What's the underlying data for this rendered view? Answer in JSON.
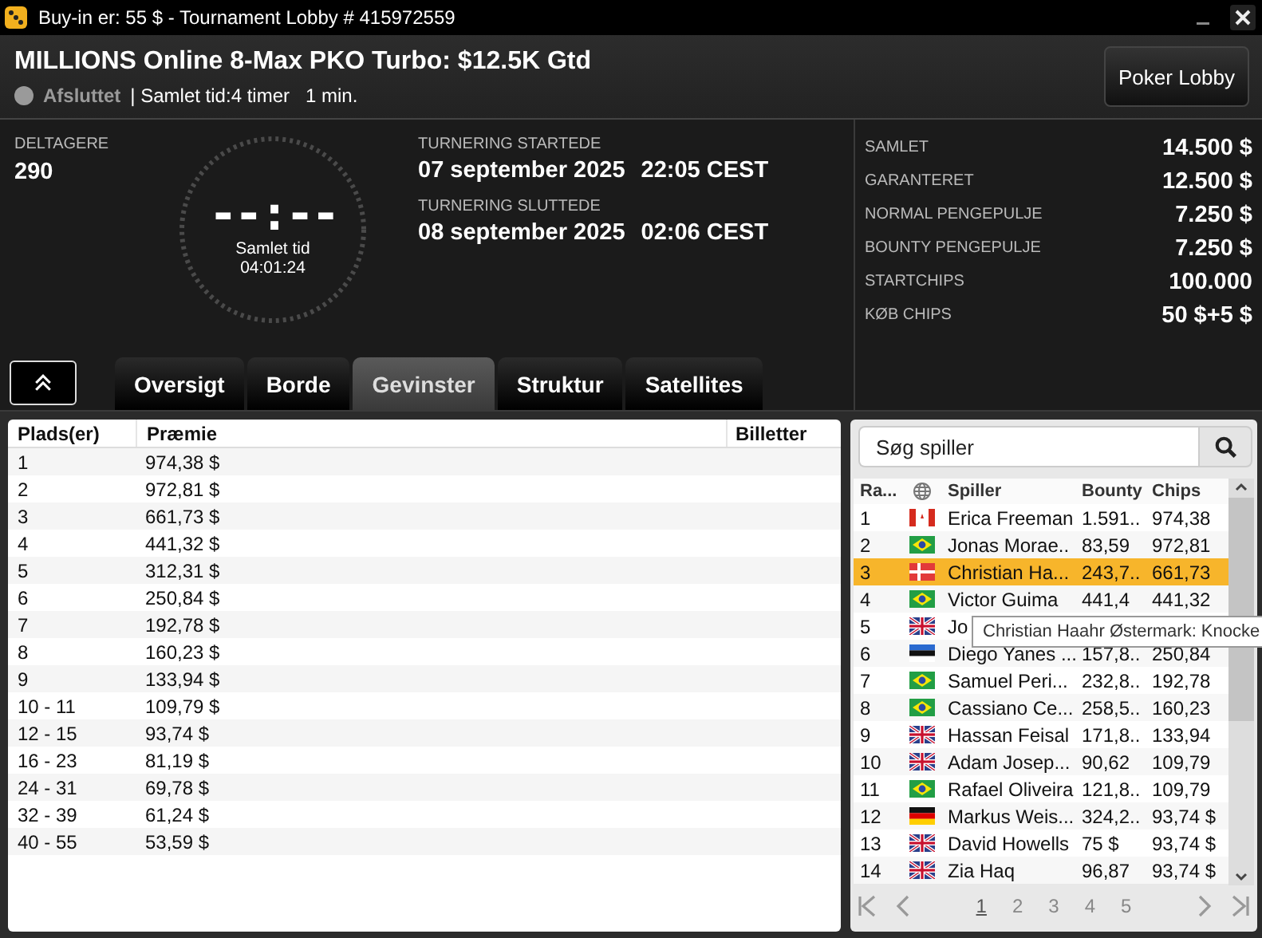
{
  "window": {
    "title": "Buy-in er: 55 $ - Tournament Lobby # 415972559"
  },
  "header": {
    "title": "MILLIONS Online 8-Max PKO Turbo: $12.5K Gtd",
    "status": "Afsluttet",
    "duration": "| Samlet tid:4 timer   1 min.",
    "lobby_button": "Poker Lobby"
  },
  "entrants": {
    "label": "DELTAGERE",
    "value": "290"
  },
  "clock": {
    "display": "--:--",
    "label": "Samlet tid",
    "time": "04:01:24"
  },
  "dates": [
    {
      "label": "TURNERING STARTEDE",
      "date": "07 september 2025",
      "time": "22:05 CEST"
    },
    {
      "label": "TURNERING SLUTTEDE",
      "date": "08 september 2025",
      "time": "02:06 CEST"
    }
  ],
  "stats": [
    {
      "label": "SAMLET",
      "value": "14.500 $"
    },
    {
      "label": "GARANTERET",
      "value": "12.500 $"
    },
    {
      "label": "NORMAL PENGEPULJE",
      "value": "7.250 $"
    },
    {
      "label": "BOUNTY PENGEPULJE",
      "value": "7.250 $"
    },
    {
      "label": "STARTCHIPS",
      "value": "100.000"
    },
    {
      "label": "KØB CHIPS",
      "value": "50 $+5 $"
    }
  ],
  "tabs": [
    {
      "label": "Oversigt",
      "selected": false
    },
    {
      "label": "Borde",
      "selected": false
    },
    {
      "label": "Gevinster",
      "selected": true
    },
    {
      "label": "Struktur",
      "selected": false
    },
    {
      "label": "Satellites",
      "selected": false
    }
  ],
  "prizes": {
    "columns": [
      "Plads(er)",
      "Præmie",
      "Billetter"
    ],
    "rows": [
      [
        "1",
        "974,38 $"
      ],
      [
        "2",
        "972,81 $"
      ],
      [
        "3",
        "661,73 $"
      ],
      [
        "4",
        "441,32 $"
      ],
      [
        "5",
        "312,31 $"
      ],
      [
        "6",
        "250,84 $"
      ],
      [
        "7",
        "192,78 $"
      ],
      [
        "8",
        "160,23 $"
      ],
      [
        "9",
        "133,94 $"
      ],
      [
        "10 - 11",
        "109,79 $"
      ],
      [
        "12 - 15",
        "93,74 $"
      ],
      [
        "16 - 23",
        "81,19 $"
      ],
      [
        "24 - 31",
        "69,78 $"
      ],
      [
        "32 - 39",
        "61,24 $"
      ],
      [
        "40 - 55",
        "53,59 $"
      ]
    ]
  },
  "players": {
    "search": {
      "placeholder": "Søg spiller"
    },
    "columns": [
      "Ra...",
      "Spiller",
      "Bounty",
      "Chips"
    ],
    "rows": [
      {
        "rank": "1",
        "kind": "flag-ca",
        "name": "Erica Freeman",
        "bounty": "1.591..",
        "chips": "974,38",
        "selected": false
      },
      {
        "rank": "2",
        "kind": "flag-br",
        "name": "Jonas Morae..",
        "bounty": "83,59",
        "chips": "972,81",
        "selected": false
      },
      {
        "rank": "3",
        "kind": "flag-dk",
        "name": "Christian Ha...",
        "bounty": "243,7..",
        "chips": "661,73",
        "selected": true
      },
      {
        "rank": "4",
        "kind": "flag-br",
        "name": "Victor Guima",
        "bounty": "441,4",
        "chips": "441,32",
        "selected": false
      },
      {
        "rank": "5",
        "kind": "flag-gb",
        "name": "Jo",
        "selected": false
      },
      {
        "rank": "6",
        "kind": "flag-ee",
        "name": "Diego Yanes ...",
        "bounty": "157,8..",
        "chips": "250,84",
        "selected": false
      },
      {
        "rank": "7",
        "kind": "flag-br",
        "name": "Samuel Peri...",
        "bounty": "232,8..",
        "chips": "192,78",
        "selected": false
      },
      {
        "rank": "8",
        "kind": "flag-br",
        "name": "Cassiano Ce...",
        "bounty": "258,5..",
        "chips": "160,23",
        "selected": false
      },
      {
        "rank": "9",
        "kind": "flag-gb",
        "name": "Hassan Feisal",
        "bounty": "171,8..",
        "chips": "133,94",
        "selected": false
      },
      {
        "rank": "10",
        "kind": "flag-gb",
        "name": "Adam Josep...",
        "bounty": "90,62",
        "chips": "109,79",
        "selected": false
      },
      {
        "rank": "11",
        "kind": "flag-br",
        "name": "Rafael Oliveira",
        "bounty": "121,8..",
        "chips": "109,79",
        "selected": false
      },
      {
        "rank": "12",
        "kind": "flag-de",
        "name": "Markus Weis...",
        "bounty": "324,2..",
        "chips": "93,74 $",
        "selected": false
      },
      {
        "rank": "13",
        "kind": "flag-gb",
        "name": "David Howells",
        "bounty": "75 $",
        "chips": "93,74 $",
        "selected": false
      },
      {
        "rank": "14",
        "kind": "flag-gb",
        "name": "Zia Haq",
        "bounty": "96,87",
        "chips": "93,74 $",
        "selected": false
      }
    ],
    "tooltip": "Christian Haahr Østermark: Knocke",
    "pages": [
      {
        "label": "1",
        "selected": true
      },
      {
        "label": "2",
        "selected": false
      },
      {
        "label": "3",
        "selected": false
      },
      {
        "label": "4",
        "selected": false
      },
      {
        "label": "5",
        "selected": false
      }
    ]
  }
}
